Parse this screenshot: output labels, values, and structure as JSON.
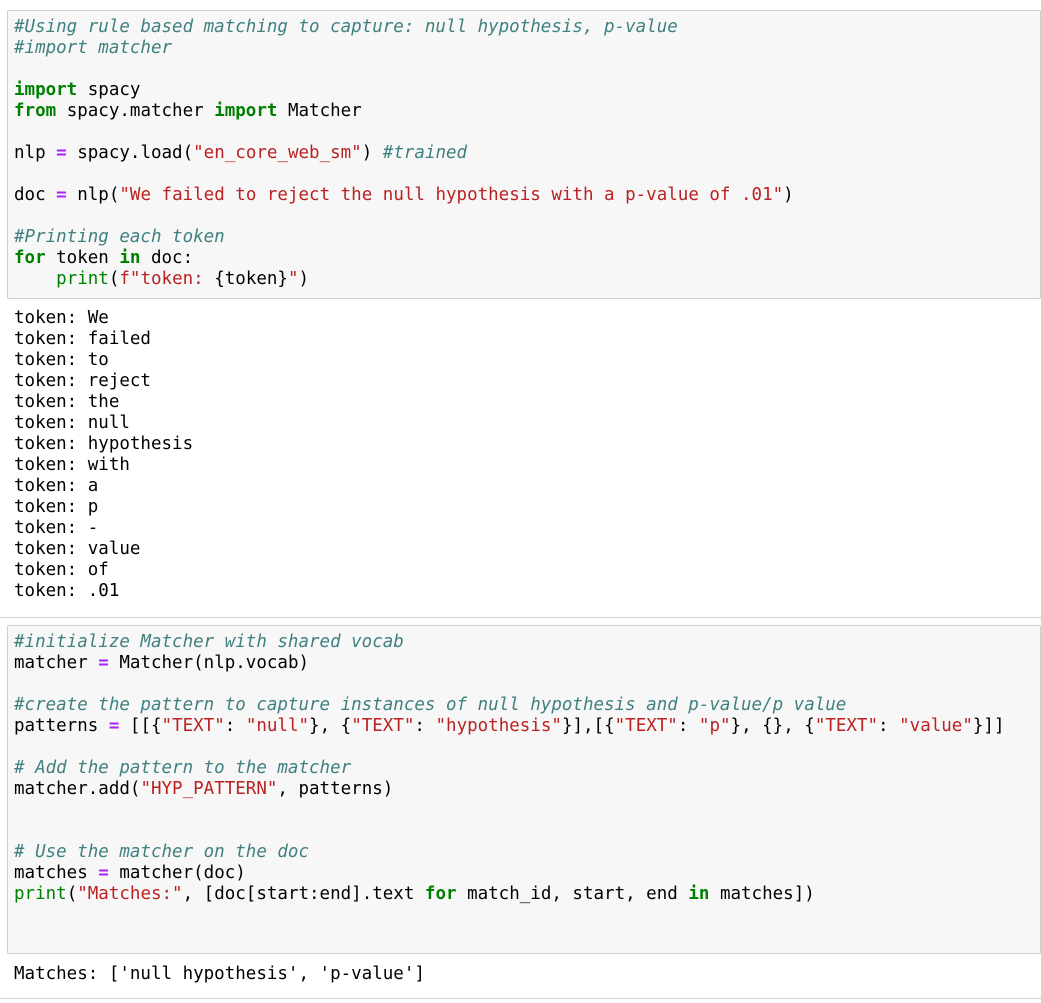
{
  "cells": [
    {
      "input_lines": [
        [
          {
            "t": "#Using rule based matching to capture: null hypothesis, p-value",
            "c": "c"
          }
        ],
        [
          {
            "t": "#import matcher",
            "c": "c"
          }
        ],
        [],
        [
          {
            "t": "import",
            "c": "k"
          },
          {
            "t": " spacy",
            "c": ""
          }
        ],
        [
          {
            "t": "from",
            "c": "k"
          },
          {
            "t": " spacy.matcher ",
            "c": ""
          },
          {
            "t": "import",
            "c": "k"
          },
          {
            "t": " Matcher",
            "c": ""
          }
        ],
        [],
        [
          {
            "t": "nlp ",
            "c": ""
          },
          {
            "t": "=",
            "c": "o"
          },
          {
            "t": " spacy.load(",
            "c": ""
          },
          {
            "t": "\"en_core_web_sm\"",
            "c": "s"
          },
          {
            "t": ") ",
            "c": ""
          },
          {
            "t": "#trained",
            "c": "c"
          }
        ],
        [],
        [
          {
            "t": "doc ",
            "c": ""
          },
          {
            "t": "=",
            "c": "o"
          },
          {
            "t": " nlp(",
            "c": ""
          },
          {
            "t": "\"We failed to reject the null hypothesis with a p-value of .01\"",
            "c": "s"
          },
          {
            "t": ")",
            "c": ""
          }
        ],
        [],
        [
          {
            "t": "#Printing each token",
            "c": "c"
          }
        ],
        [
          {
            "t": "for",
            "c": "k"
          },
          {
            "t": " token ",
            "c": ""
          },
          {
            "t": "in",
            "c": "k"
          },
          {
            "t": " doc:",
            "c": ""
          }
        ],
        [
          {
            "t": "    ",
            "c": ""
          },
          {
            "t": "print",
            "c": "b"
          },
          {
            "t": "(",
            "c": ""
          },
          {
            "t": "f\"token: ",
            "c": "s"
          },
          {
            "t": "{token}",
            "c": "si"
          },
          {
            "t": "\"",
            "c": "s"
          },
          {
            "t": ")",
            "c": ""
          }
        ]
      ],
      "output_lines": [
        "token: We",
        "token: failed",
        "token: to",
        "token: reject",
        "token: the",
        "token: null",
        "token: hypothesis",
        "token: with",
        "token: a",
        "token: p",
        "token: -",
        "token: value",
        "token: of",
        "token: .01"
      ]
    },
    {
      "input_lines": [
        [
          {
            "t": "#initialize Matcher with shared vocab",
            "c": "c"
          }
        ],
        [
          {
            "t": "matcher ",
            "c": ""
          },
          {
            "t": "=",
            "c": "o"
          },
          {
            "t": " Matcher(nlp.vocab)",
            "c": ""
          }
        ],
        [],
        [
          {
            "t": "#create the pattern to capture instances of null hypothesis and p-value/p value",
            "c": "c"
          }
        ],
        [
          {
            "t": "patterns ",
            "c": ""
          },
          {
            "t": "=",
            "c": "o"
          },
          {
            "t": " [[{",
            "c": ""
          },
          {
            "t": "\"TEXT\"",
            "c": "s"
          },
          {
            "t": ": ",
            "c": ""
          },
          {
            "t": "\"null\"",
            "c": "s"
          },
          {
            "t": "}, {",
            "c": ""
          },
          {
            "t": "\"TEXT\"",
            "c": "s"
          },
          {
            "t": ": ",
            "c": ""
          },
          {
            "t": "\"hypothesis\"",
            "c": "s"
          },
          {
            "t": "}],[{",
            "c": ""
          },
          {
            "t": "\"TEXT\"",
            "c": "s"
          },
          {
            "t": ": ",
            "c": ""
          },
          {
            "t": "\"p\"",
            "c": "s"
          },
          {
            "t": "}, {}, {",
            "c": ""
          },
          {
            "t": "\"TEXT\"",
            "c": "s"
          },
          {
            "t": ": ",
            "c": ""
          },
          {
            "t": "\"value\"",
            "c": "s"
          },
          {
            "t": "}]]",
            "c": ""
          }
        ],
        [],
        [
          {
            "t": "# Add the pattern to the matcher",
            "c": "c"
          }
        ],
        [
          {
            "t": "matcher.add(",
            "c": ""
          },
          {
            "t": "\"HYP_PATTERN\"",
            "c": "s"
          },
          {
            "t": ", patterns)",
            "c": ""
          }
        ],
        [],
        [],
        [
          {
            "t": "# Use the matcher on the doc",
            "c": "c"
          }
        ],
        [
          {
            "t": "matches ",
            "c": ""
          },
          {
            "t": "=",
            "c": "o"
          },
          {
            "t": " matcher(doc)",
            "c": ""
          }
        ],
        [
          {
            "t": "print",
            "c": "b"
          },
          {
            "t": "(",
            "c": ""
          },
          {
            "t": "\"Matches:\"",
            "c": "s"
          },
          {
            "t": ", [doc[start:end].text ",
            "c": ""
          },
          {
            "t": "for",
            "c": "k"
          },
          {
            "t": " match_id, start, end ",
            "c": ""
          },
          {
            "t": "in",
            "c": "k"
          },
          {
            "t": " matches])",
            "c": ""
          }
        ]
      ],
      "output_lines": [
        "Matches: ['null hypothesis', 'p-value']"
      ]
    }
  ]
}
